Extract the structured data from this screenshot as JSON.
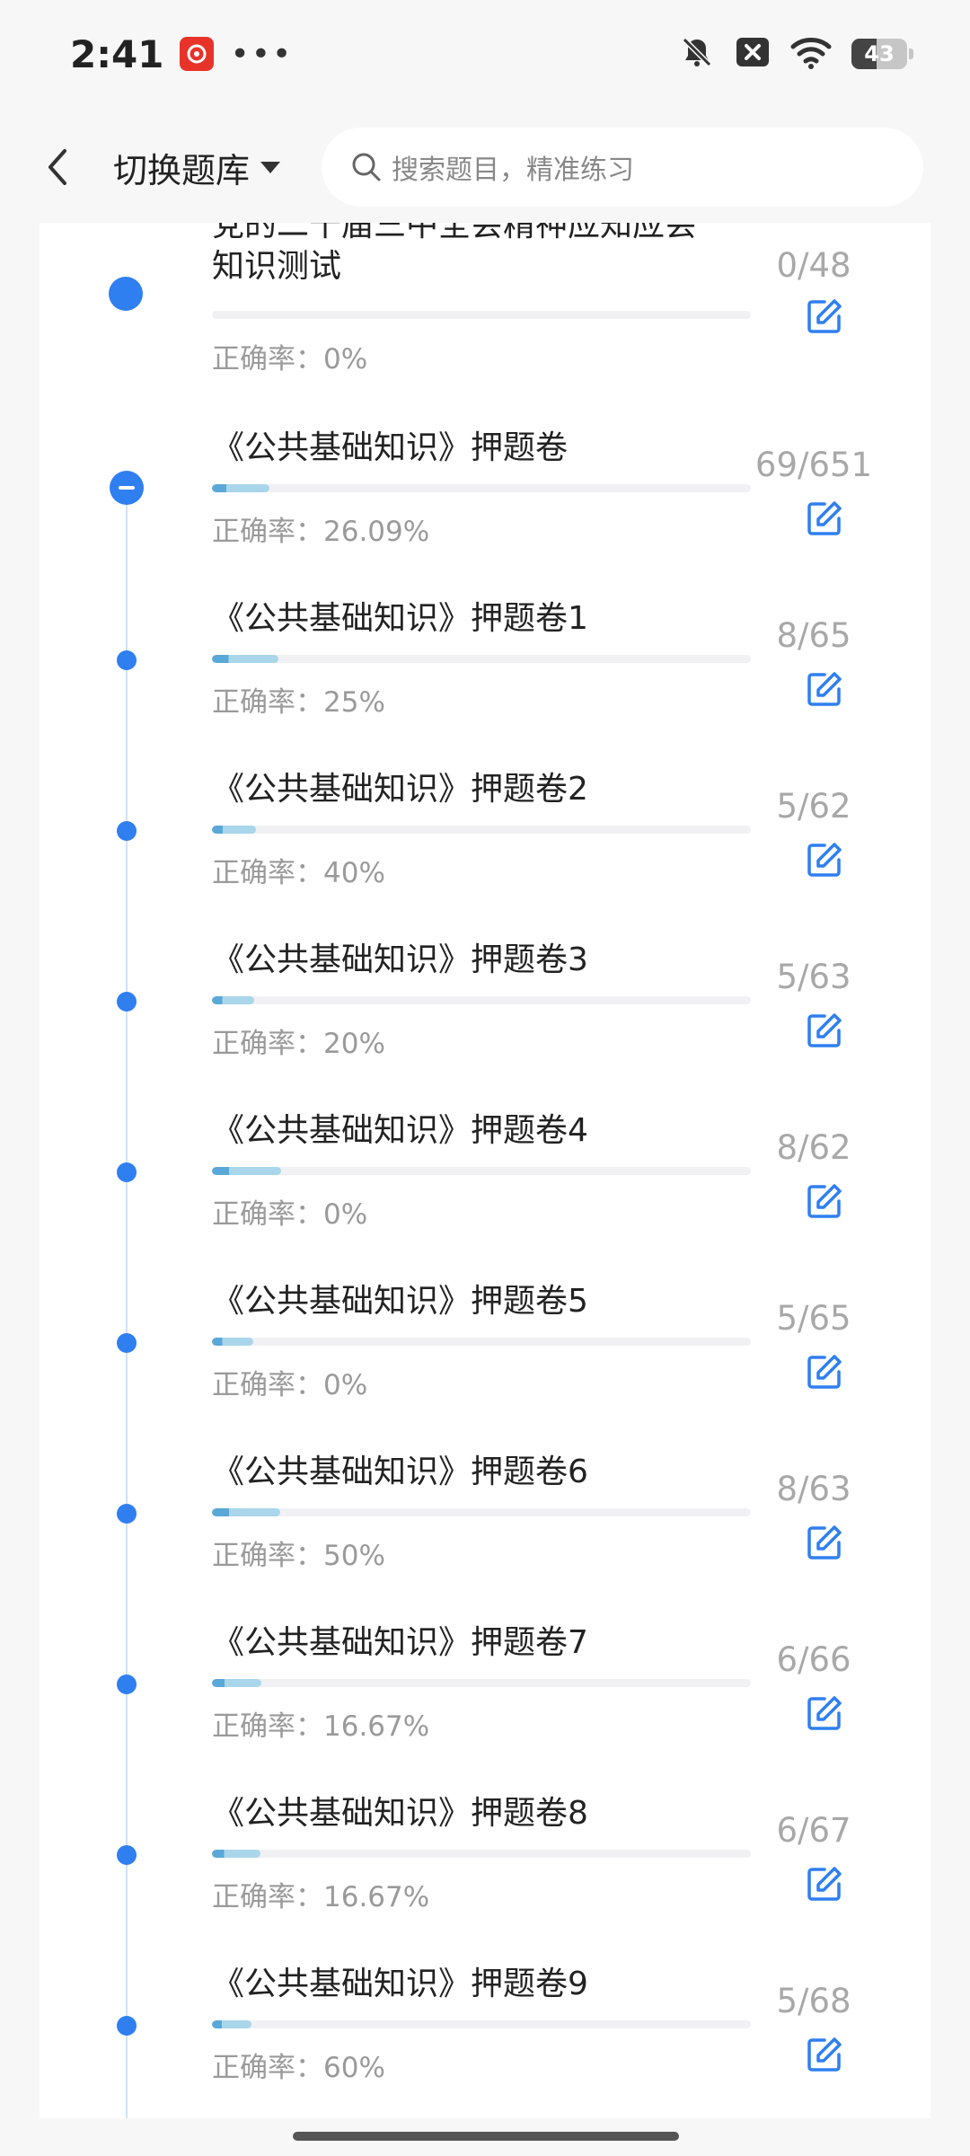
{
  "status_bar": {
    "time": "2:41",
    "battery": "43",
    "app_badge_icon": "netease-music-icon"
  },
  "header": {
    "switch_label": "切换题库",
    "search_placeholder": "搜索题目，精准练习"
  },
  "colors": {
    "accent": "#2f7ff0",
    "progress": "#a9d6ea",
    "progress_dark": "#5aa8d8"
  },
  "accuracy_prefix": "正确率：",
  "items": [
    {
      "title_line1": "党的二十届三中全会精神应知应会",
      "title_line2": "知识测试",
      "accuracy": "正确率：0%",
      "count": "0/48",
      "progress": 0
    },
    {
      "title": "《公共基础知识》押题卷",
      "accuracy": "正确率：26.09%",
      "count": "69/651",
      "progress": 0.106
    },
    {
      "title": "《公共基础知识》押题卷1",
      "accuracy": "正确率：25%",
      "count": "8/65",
      "progress": 0.123
    },
    {
      "title": "《公共基础知识》押题卷2",
      "accuracy": "正确率：40%",
      "count": "5/62",
      "progress": 0.081
    },
    {
      "title": "《公共基础知识》押题卷3",
      "accuracy": "正确率：20%",
      "count": "5/63",
      "progress": 0.079
    },
    {
      "title": "《公共基础知识》押题卷4",
      "accuracy": "正确率：0%",
      "count": "8/62",
      "progress": 0.129
    },
    {
      "title": "《公共基础知识》押题卷5",
      "accuracy": "正确率：0%",
      "count": "5/65",
      "progress": 0.077
    },
    {
      "title": "《公共基础知识》押题卷6",
      "accuracy": "正确率：50%",
      "count": "8/63",
      "progress": 0.127
    },
    {
      "title": "《公共基础知识》押题卷7",
      "accuracy": "正确率：16.67%",
      "count": "6/66",
      "progress": 0.091
    },
    {
      "title": "《公共基础知识》押题卷8",
      "accuracy": "正确率：16.67%",
      "count": "6/67",
      "progress": 0.09
    },
    {
      "title": "《公共基础知识》押题卷9",
      "accuracy": "正确率：60%",
      "count": "5/68",
      "progress": 0.074
    }
  ]
}
